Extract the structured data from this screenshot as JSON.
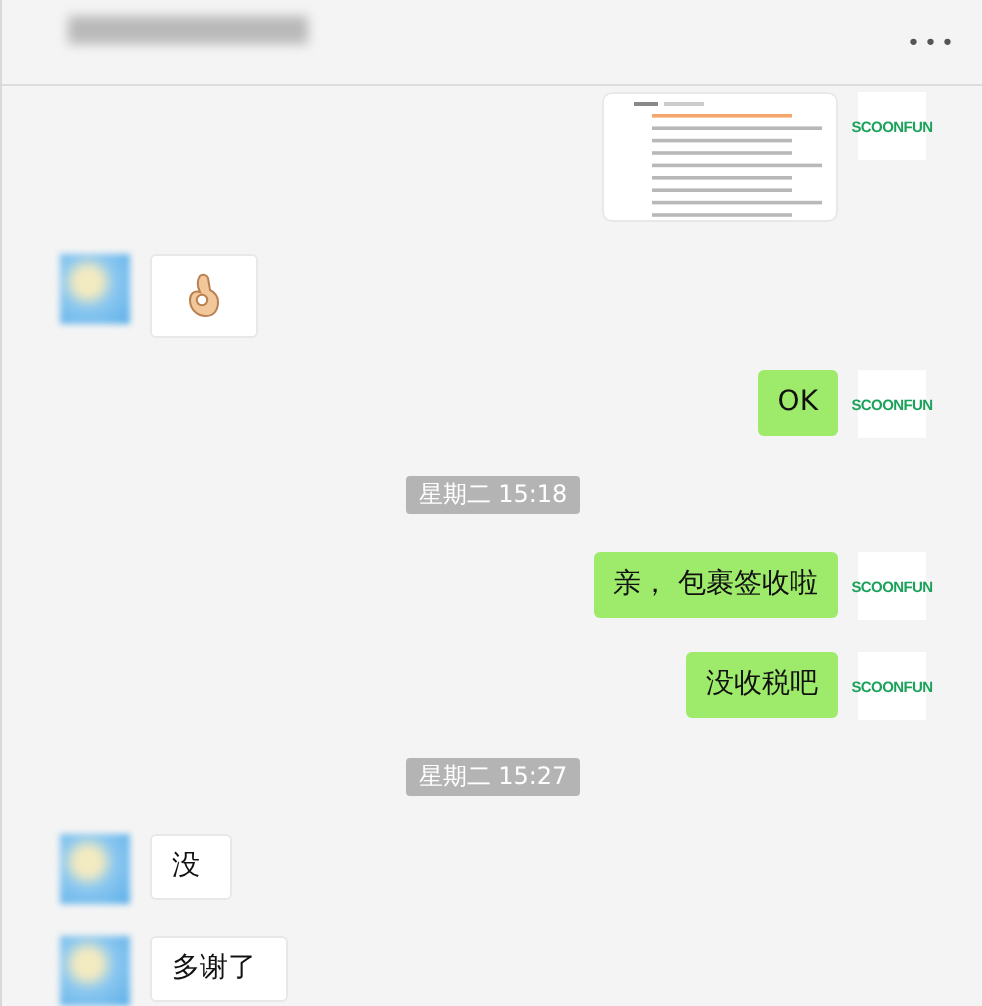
{
  "header": {
    "menu": "•••"
  },
  "messages": [
    {
      "outgoing": true,
      "avatar": "SCOONFUN"
    },
    {
      "kind": "emoji",
      "outgoing": false
    },
    {
      "kind": "text",
      "outgoing": true,
      "text": "OK",
      "avatar": "SCOONFUN"
    },
    {
      "kind": "time",
      "text": "星期二 15:18"
    },
    {
      "kind": "text",
      "outgoing": true,
      "text": "亲， 包裹签收啦",
      "avatar": "SCOONFUN"
    },
    {
      "kind": "text",
      "outgoing": true,
      "text": "没收税吧",
      "avatar": "SCOONFUN"
    },
    {
      "kind": "time",
      "text": "星期二 15:27"
    },
    {
      "kind": "text",
      "outgoing": false,
      "text": "没"
    },
    {
      "kind": "text",
      "outgoing": false,
      "text": "多谢了"
    }
  ]
}
